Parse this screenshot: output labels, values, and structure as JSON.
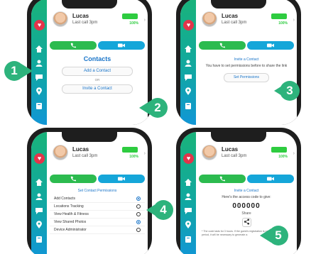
{
  "contact": {
    "name": "Lucas",
    "last_call": "Last call 3pm",
    "battery": "100%"
  },
  "screen1": {
    "title": "Contacts",
    "add_button": "Add a Contact",
    "or_text": "OR",
    "invite_button": "Invite a Contact"
  },
  "screen2": {
    "title": "Invite a Contact",
    "note": "You have to set permissions before to share the link",
    "permissions_button": "Set Permissions"
  },
  "screen3": {
    "title": "Set Contact Permissions",
    "permissions": [
      {
        "label": "Add Contacts",
        "on": true
      },
      {
        "label": "Locations Tracking",
        "on": false
      },
      {
        "label": "View Health & Fitness",
        "on": false
      },
      {
        "label": "View Shared Photos",
        "on": true
      },
      {
        "label": "Device Administrator",
        "on": false
      }
    ]
  },
  "screen4": {
    "title": "Invite a Contact",
    "code_label": "Here's the access code to give:",
    "code": "000000",
    "share_label": "Share",
    "footnote": "* The code lasts for 3 hours. If the guest's registration is not done within this period, it will be necessary to generate a"
  },
  "badges": [
    "1",
    "2",
    "3",
    "4",
    "5"
  ],
  "colors": {
    "accent_green": "#2db37c",
    "link_blue": "#1a75c9",
    "sidebar_top": "#19b37a",
    "sidebar_bottom": "#1196d6",
    "alert_red": "#e3344a"
  }
}
